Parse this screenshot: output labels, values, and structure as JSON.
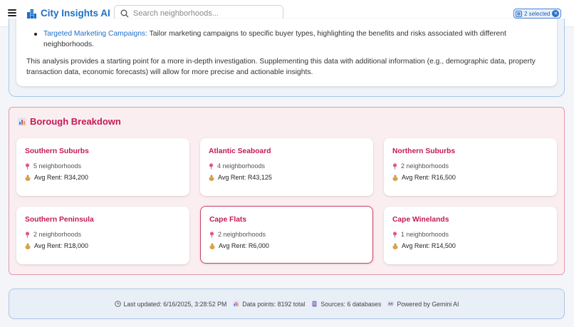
{
  "app": {
    "title": "City Insights AI"
  },
  "search": {
    "placeholder": "Search neighborhoods..."
  },
  "selection": {
    "label": "2 selected"
  },
  "analysis": {
    "bullet_label": "Targeted Marketing Campaigns:",
    "bullet_text": " Tailor marketing campaigns to specific buyer types, highlighting the benefits and risks associated with different neighborhoods.",
    "paragraph": "This analysis provides a starting point for a more in-depth investigation. Supplementing this data with additional information (e.g., demographic data, property transaction data, economic forecasts) will allow for more precise and actionable insights."
  },
  "borough": {
    "title": "Borough Breakdown",
    "cards": [
      {
        "name": "Southern Suburbs",
        "neighborhoods": "5 neighborhoods",
        "rent": "Avg Rent: R34,200"
      },
      {
        "name": "Atlantic Seaboard",
        "neighborhoods": "4 neighborhoods",
        "rent": "Avg Rent: R43,125"
      },
      {
        "name": "Northern Suburbs",
        "neighborhoods": "2 neighborhoods",
        "rent": "Avg Rent: R16,500"
      },
      {
        "name": "Southern Peninsula",
        "neighborhoods": "2 neighborhoods",
        "rent": "Avg Rent: R18,000"
      },
      {
        "name": "Cape Flats",
        "neighborhoods": "2 neighborhoods",
        "rent": "Avg Rent: R6,000"
      },
      {
        "name": "Cape Winelands",
        "neighborhoods": "1 neighborhoods",
        "rent": "Avg Rent: R14,500"
      }
    ]
  },
  "footer": {
    "updated": "Last updated: 6/16/2025, 3:28:52 PM",
    "datapoints": "Data points: 8192 total",
    "sources": "Sources: 6 databases",
    "powered": "Powered by Gemini AI"
  },
  "colors": {
    "brand": "#1f6fc6",
    "accent": "#c31a57",
    "selected_border": "#c9436b"
  },
  "icons": [
    "menu-icon",
    "city-icon",
    "search-icon",
    "selection-icon",
    "clear-icon",
    "chart-icon",
    "pin-icon",
    "money-bag-icon",
    "clock-icon",
    "bar-chart-icon",
    "database-icon",
    "ai-icon"
  ]
}
